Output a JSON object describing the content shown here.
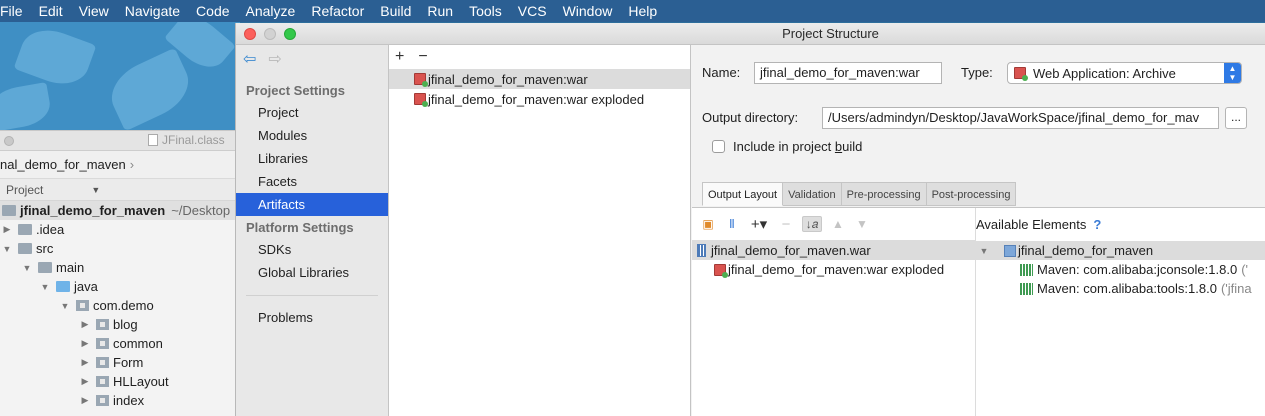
{
  "menubar": {
    "items": [
      "File",
      "Edit",
      "View",
      "Navigate",
      "Code",
      "Analyze",
      "Refactor",
      "Build",
      "Run",
      "Tools",
      "VCS",
      "Window",
      "Help"
    ]
  },
  "ide_bg": {
    "file_tab": "JFinal.class",
    "breadcrumb": "nal_demo_for_maven",
    "project_header": "Project",
    "root_name": "jfinal_demo_for_maven",
    "root_path": "~/Desktop",
    "tree": [
      ".idea",
      "src",
      "main",
      "java",
      "com.demo",
      "blog",
      "common",
      "Form",
      "HLLayout",
      "index"
    ]
  },
  "dialog": {
    "title": "Project Structure",
    "nav": {
      "project_settings": "Project Settings",
      "project_items": [
        "Project",
        "Modules",
        "Libraries",
        "Facets",
        "Artifacts"
      ],
      "platform_settings": "Platform Settings",
      "platform_items": [
        "SDKs",
        "Global Libraries"
      ],
      "problems": "Problems"
    },
    "artifacts": {
      "add": "+",
      "remove": "−",
      "items": [
        "jfinal_demo_for_maven:war",
        "jfinal_demo_for_maven:war exploded"
      ]
    },
    "detail": {
      "name_label": "Name:",
      "name_value": "jfinal_demo_for_maven:war",
      "type_label": "Type:",
      "type_value": "Web Application: Archive",
      "output_label": "Output directory:",
      "output_value": "/Users/admindyn/Desktop/JavaWorkSpace/jfinal_demo_for_mav",
      "browse": "...",
      "include_pre": "Include in project ",
      "include_mnemonic": "b",
      "include_post": "uild",
      "tabs": [
        "Output Layout",
        "Validation",
        "Pre-processing",
        "Post-processing"
      ],
      "layout_tree": [
        "jfinal_demo_for_maven.war",
        "jfinal_demo_for_maven:war exploded"
      ],
      "available_title": "Available Elements",
      "available_help": "?",
      "available_root": "jfinal_demo_for_maven",
      "available_items": [
        {
          "label": "Maven: com.alibaba:jconsole:1.8.0",
          "extra": "('"
        },
        {
          "label": "Maven: com.alibaba:tools:1.8.0",
          "extra": "('jfina"
        }
      ]
    }
  }
}
